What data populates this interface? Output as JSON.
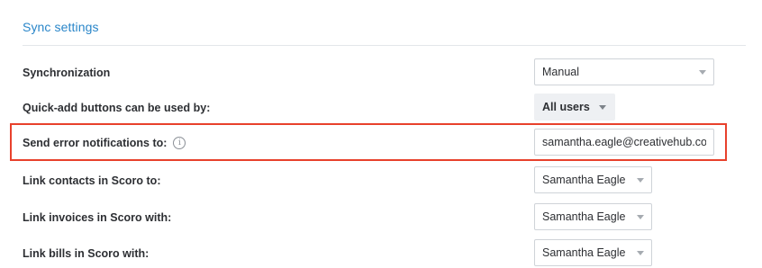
{
  "section": {
    "title": "Sync settings"
  },
  "rows": {
    "synchronization": {
      "label": "Synchronization",
      "value": "Manual"
    },
    "quick_add": {
      "label": "Quick-add buttons can be used by:",
      "value": "All users"
    },
    "error_notifications": {
      "label": "Send error notifications to:",
      "info_icon": "i",
      "value": "samantha.eagle@creativehub.com"
    },
    "link_contacts": {
      "label": "Link contacts in Scoro to:",
      "value": "Samantha Eagle"
    },
    "link_invoices": {
      "label": "Link invoices in Scoro with:",
      "value": "Samantha Eagle"
    },
    "link_bills": {
      "label": "Link bills in Scoro with:",
      "value": "Samantha Eagle"
    }
  },
  "colors": {
    "accent": "#2a86c9",
    "highlight": "#e8412c"
  },
  "icons": {
    "info": "info-icon",
    "dropdown": "chevron-down-icon"
  }
}
